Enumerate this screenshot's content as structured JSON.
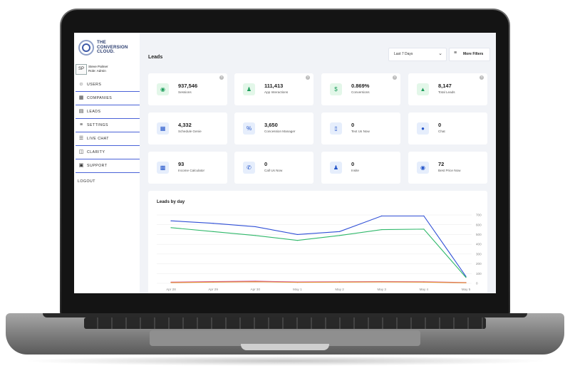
{
  "sidebar": {
    "logo_lines": [
      "THE",
      "CONVERSION",
      "CLOUD."
    ],
    "user": {
      "initials": "SP",
      "name": "Steve Palmer",
      "role": "Role: Admin"
    },
    "items": [
      {
        "label": "USERS",
        "icon": "user-icon"
      },
      {
        "label": "COMPANIES",
        "icon": "building-icon"
      },
      {
        "label": "LEADS",
        "icon": "list-icon"
      },
      {
        "label": "SETTINGS",
        "icon": "sliders-icon"
      },
      {
        "label": "LIVE CHAT",
        "icon": "chat-icon"
      },
      {
        "label": "CLARITY",
        "icon": "document-icon"
      },
      {
        "label": "SUPPORT",
        "icon": "support-icon"
      }
    ],
    "logout": "LOGOUT"
  },
  "header": {
    "title": "Leads",
    "date_range": "Last 7 Days",
    "filters_label": "More Filters"
  },
  "cards": [
    {
      "value": "937,546",
      "label": "Sessions",
      "icon": "eye-icon",
      "accent": "green",
      "help": true
    },
    {
      "value": "111,413",
      "label": "App Interactions",
      "icon": "person-icon",
      "accent": "green",
      "help": true
    },
    {
      "value": "0.869%",
      "label": "Conversions",
      "icon": "dollar-icon",
      "accent": "green",
      "help": true
    },
    {
      "value": "8,147",
      "label": "Total Leads",
      "icon": "flame-icon",
      "accent": "green",
      "help": true
    },
    {
      "value": "4,332",
      "label": "Schedule Genie",
      "icon": "calendar-icon",
      "accent": "blue",
      "help": false
    },
    {
      "value": "3,650",
      "label": "Concession Manager",
      "icon": "tag-icon",
      "accent": "blue",
      "help": false
    },
    {
      "value": "0",
      "label": "Text Us Now",
      "icon": "phone-icon",
      "accent": "blue",
      "help": false
    },
    {
      "value": "0",
      "label": "Chat",
      "icon": "chat-bubble-icon",
      "accent": "blue",
      "help": false
    },
    {
      "value": "93",
      "label": "Income Calculator",
      "icon": "calculator-icon",
      "accent": "blue",
      "help": false
    },
    {
      "value": "0",
      "label": "Call Us Now",
      "icon": "call-icon",
      "accent": "blue",
      "help": false
    },
    {
      "value": "0",
      "label": "Insite",
      "icon": "people-icon",
      "accent": "blue",
      "help": false
    },
    {
      "value": "72",
      "label": "Best Price Now",
      "icon": "coin-icon",
      "accent": "blue",
      "help": false
    }
  ],
  "chart_data": {
    "type": "line",
    "title": "Leads by day",
    "categories": [
      "Apr 28",
      "Apr 29",
      "Apr 30",
      "May 1",
      "May 2",
      "May 3",
      "May 4",
      "May 5"
    ],
    "ylim": [
      0,
      700
    ],
    "yticks": [
      0,
      100,
      200,
      300,
      400,
      500,
      600,
      700
    ],
    "grid": true,
    "series": [
      {
        "color": "#2f4fd6",
        "values": [
          640,
          615,
          580,
          500,
          530,
          690,
          690,
          70
        ]
      },
      {
        "color": "#2fb86a",
        "values": [
          570,
          530,
          490,
          440,
          490,
          550,
          555,
          60
        ]
      },
      {
        "color": "#d15aa7",
        "values": [
          12,
          18,
          22,
          14,
          16,
          18,
          16,
          8
        ]
      },
      {
        "color": "#e48a2a",
        "values": [
          8,
          12,
          16,
          10,
          12,
          14,
          12,
          6
        ]
      }
    ]
  }
}
